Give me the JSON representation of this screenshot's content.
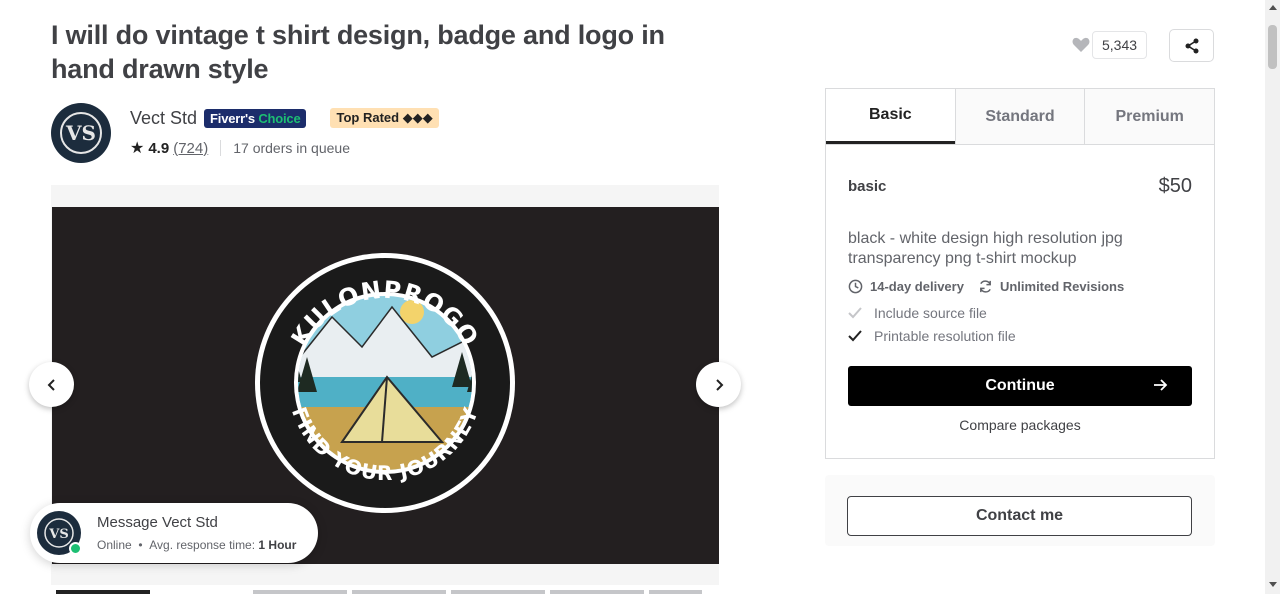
{
  "gig": {
    "title": "I will do vintage t shirt design, badge and logo in hand drawn style"
  },
  "seller": {
    "name": "Vect Std",
    "choice_badge_part1": "Fiverr's",
    "choice_badge_part2": "Choice",
    "top_rated_label": "Top Rated",
    "top_rated_diamonds": "◆◆◆",
    "rating": "4.9",
    "reviews": "(724)",
    "queue": "17 orders in queue",
    "avatar_icon": "vs-monogram-logo"
  },
  "gallery": {
    "image_top_text": "KULONPROGO",
    "image_bottom_text": "FIND YOUR JOURNEY",
    "prev_icon": "chevron-left-icon",
    "next_icon": "chevron-right-icon"
  },
  "message": {
    "title": "Message Vect Std",
    "status": "Online",
    "bullet": "•",
    "response_label": "Avg. response time:",
    "response_value": "1 Hour"
  },
  "actions": {
    "like_count": "5,343"
  },
  "packages": {
    "tabs": [
      {
        "label": "Basic",
        "active": true
      },
      {
        "label": "Standard",
        "active": false
      },
      {
        "label": "Premium",
        "active": false
      }
    ],
    "selected": {
      "name": "basic",
      "price": "$50",
      "description": "black - white design high resolution jpg transparency png t-shirt mockup",
      "delivery": "14-day delivery",
      "revisions": "Unlimited Revisions",
      "features": [
        {
          "label": "Include source file",
          "included": false
        },
        {
          "label": "Printable resolution file",
          "included": true
        }
      ]
    },
    "continue_label": "Continue",
    "compare_label": "Compare packages"
  },
  "contact": {
    "label": "Contact me"
  },
  "colors": {
    "accent_green": "#1dbf73",
    "choice_navy": "#1c2d6b",
    "top_rated_bg": "#ffe0b3",
    "text_dark": "#404145"
  }
}
